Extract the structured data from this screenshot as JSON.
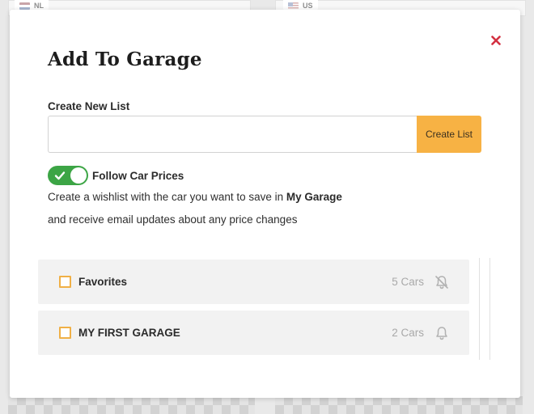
{
  "background": {
    "left_flag": {
      "code": "NL",
      "icon": "netherlands-flag-icon"
    },
    "right_flag": {
      "code": "US",
      "icon": "us-flag-icon"
    }
  },
  "modal": {
    "title": "Add To Garage",
    "close_icon": "close-icon",
    "create_list_label": "Create New List",
    "new_list_input": {
      "value": "",
      "placeholder": ""
    },
    "create_button_label": "Create List",
    "follow_toggle": {
      "label": "Follow Car Prices",
      "checked": true,
      "icon": "check-icon"
    },
    "description": {
      "line1_prefix": "Create a wishlist with the car you want to save in ",
      "line1_bold": "My Garage",
      "line2": "and receive email updates about any price changes"
    },
    "lists": [
      {
        "name": "Favorites",
        "count": "5 Cars",
        "checked": false,
        "notify_icon": "bell-off-icon"
      },
      {
        "name": "MY FIRST GARAGE",
        "count": "2 Cars",
        "checked": false,
        "notify_icon": "bell-icon"
      }
    ]
  },
  "colors": {
    "accent": "#f7b244",
    "toggle_on": "#3ca545",
    "close": "#d33041",
    "row_bg": "#f2f2f2"
  }
}
